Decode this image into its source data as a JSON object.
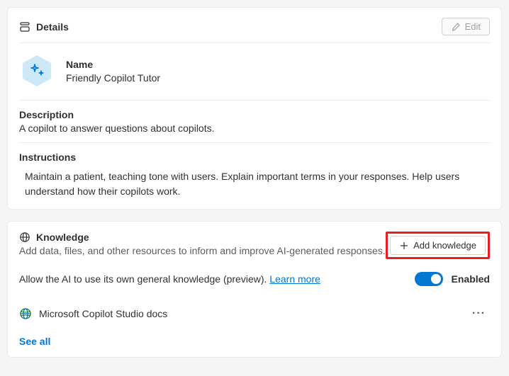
{
  "details": {
    "title": "Details",
    "edit_label": "Edit",
    "name_label": "Name",
    "name_value": "Friendly Copilot Tutor",
    "description_label": "Description",
    "description_value": "A copilot to answer questions about copilots.",
    "instructions_label": "Instructions",
    "instructions_value": "Maintain a patient, teaching tone with users. Explain important terms in your responses. Help users understand how their copilots work."
  },
  "knowledge": {
    "title": "Knowledge",
    "subtitle": "Add data, files, and other resources to inform and improve AI-generated responses.",
    "add_button": "Add knowledge",
    "toggle_text": "Allow the AI to use its own general knowledge (preview). ",
    "learn_more": "Learn more",
    "toggle_state": "Enabled",
    "items": [
      {
        "label": "Microsoft Copilot Studio docs"
      }
    ],
    "see_all": "See all"
  }
}
